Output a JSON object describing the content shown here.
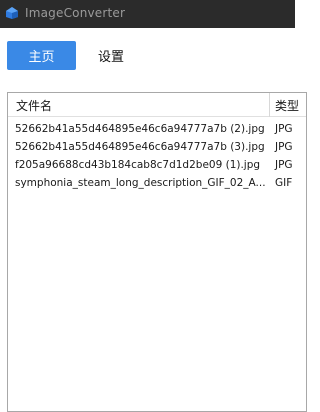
{
  "window": {
    "title": "ImageConverter",
    "icon": "app-logo-icon",
    "colors": {
      "titlebar": "#2b2b2b",
      "accent": "#3a89e6"
    }
  },
  "nav": {
    "home_label": "主页",
    "settings_label": "设置",
    "selected": "home"
  },
  "table": {
    "columns": [
      "文件名",
      "类型"
    ],
    "rows": [
      {
        "name": "52662b41a55d464895e46c6a94777a7b (2).jpg",
        "type": "JPG"
      },
      {
        "name": "52662b41a55d464895e46c6a94777a7b (3).jpg",
        "type": "JPG"
      },
      {
        "name": "f205a96688cd43b184cab8c7d1d2be09 (1).jpg",
        "type": "JPG"
      },
      {
        "name": "symphonia_steam_long_description_GIF_02_A...",
        "type": "GIF"
      }
    ]
  }
}
